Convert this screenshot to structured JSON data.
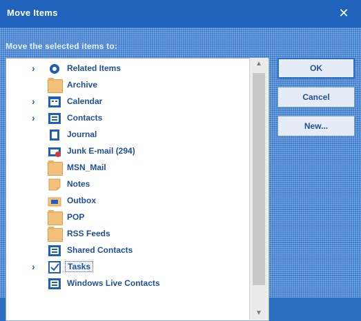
{
  "window": {
    "title": "Move Items",
    "close_icon": "close-icon"
  },
  "prompt": "Move the selected items to:",
  "folders": [
    {
      "label": "Related Items",
      "icon": "related-items-icon",
      "expandable": true
    },
    {
      "label": "Archive",
      "icon": "folder-icon",
      "expandable": false
    },
    {
      "label": "Calendar",
      "icon": "calendar-icon",
      "expandable": true
    },
    {
      "label": "Contacts",
      "icon": "contacts-icon",
      "expandable": true
    },
    {
      "label": "Journal",
      "icon": "journal-icon",
      "expandable": false
    },
    {
      "label": "Junk E-mail (294)",
      "icon": "junk-email-icon",
      "expandable": false
    },
    {
      "label": "MSN_Mail",
      "icon": "folder-icon",
      "expandable": false
    },
    {
      "label": "Notes",
      "icon": "notes-icon",
      "expandable": false
    },
    {
      "label": "Outbox",
      "icon": "outbox-icon",
      "expandable": false
    },
    {
      "label": "POP",
      "icon": "folder-icon",
      "expandable": false
    },
    {
      "label": "RSS Feeds",
      "icon": "rss-feeds-icon",
      "expandable": false
    },
    {
      "label": "Shared Contacts",
      "icon": "contacts-icon",
      "expandable": false
    },
    {
      "label": "Tasks",
      "icon": "tasks-icon",
      "expandable": true,
      "selected": true
    },
    {
      "label": "Windows Live Contacts",
      "icon": "contacts-icon",
      "expandable": false
    }
  ],
  "buttons": {
    "ok": "OK",
    "cancel": "Cancel",
    "new": "New..."
  },
  "colors": {
    "accent": "#2b6fc0",
    "label": "#1f4f9c",
    "folder": "#f2c27a"
  }
}
